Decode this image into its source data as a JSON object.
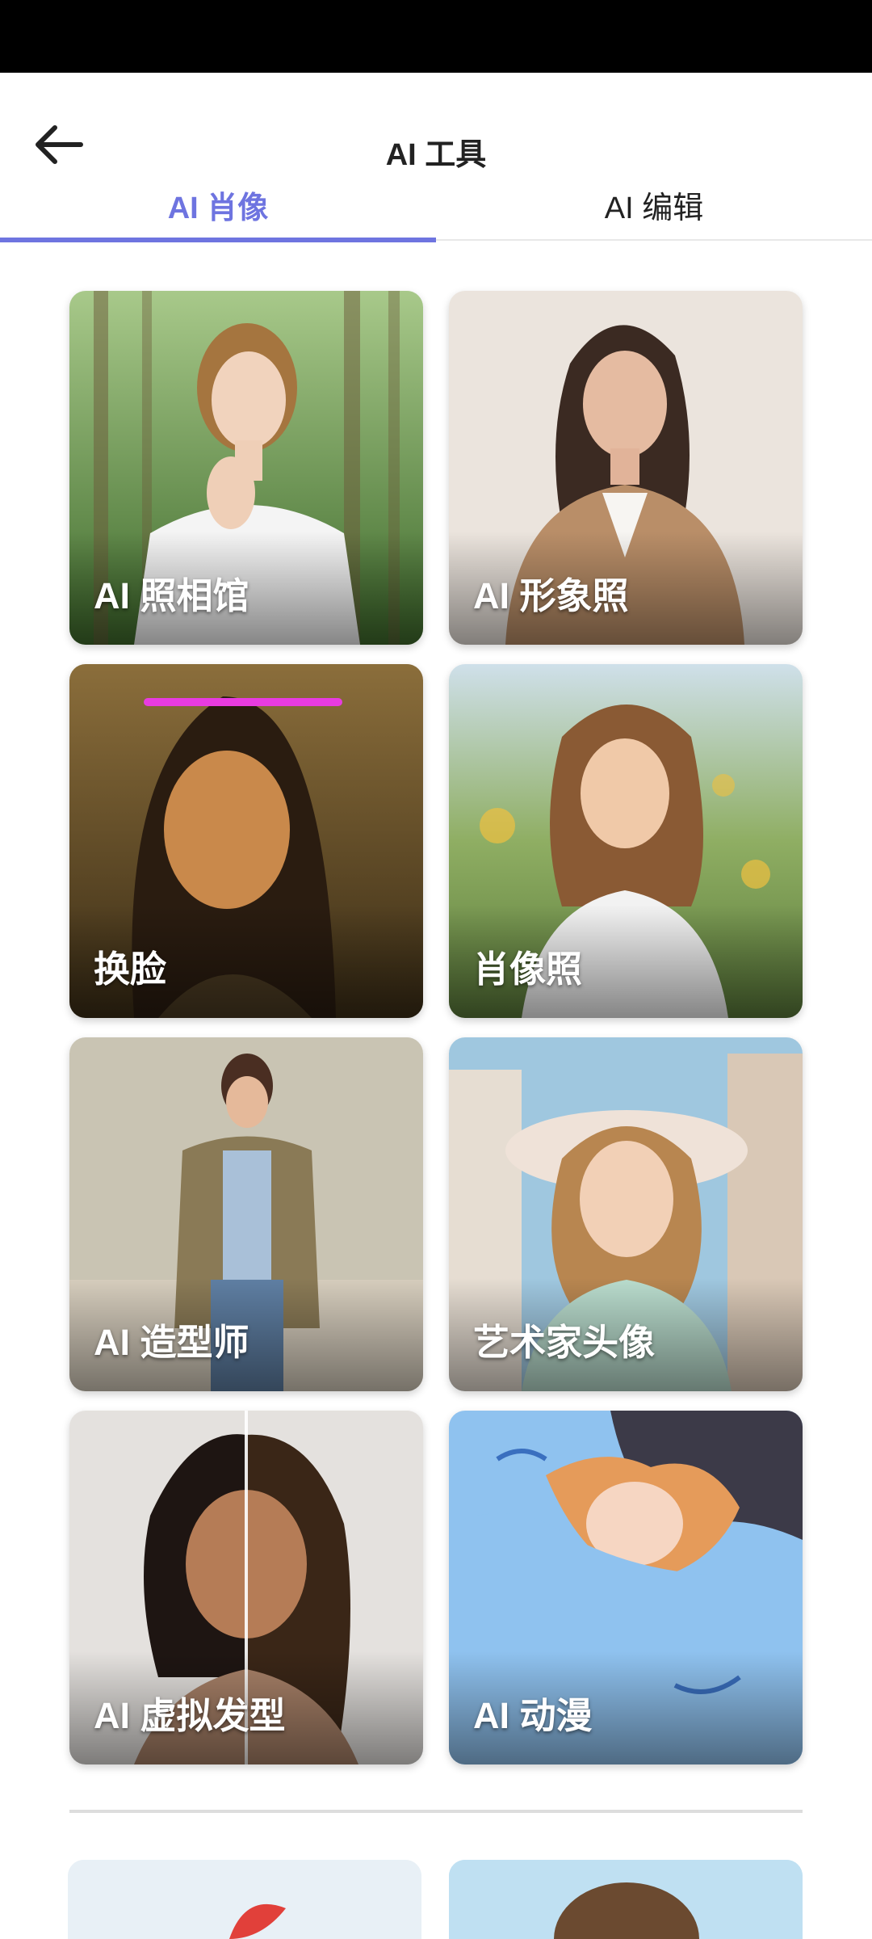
{
  "header": {
    "title": "AI 工具"
  },
  "tabs": [
    {
      "label": "AI 肖像",
      "active": true
    },
    {
      "label": "AI 编辑",
      "active": false
    }
  ],
  "accent_color": "#6e74e0",
  "cards": [
    {
      "label": "AI 照相馆",
      "icon": "portrait-forest-photo"
    },
    {
      "label": "AI 形象照",
      "icon": "portrait-business-photo"
    },
    {
      "label": "换脸",
      "icon": "face-swap-painting"
    },
    {
      "label": "肖像照",
      "icon": "portrait-outdoor-photo"
    },
    {
      "label": "AI 造型师",
      "icon": "fashion-stylist-photo"
    },
    {
      "label": "艺术家头像",
      "icon": "artistic-avatar"
    },
    {
      "label": "AI 虚拟发型",
      "icon": "virtual-hairstyle-photo"
    },
    {
      "label": "AI 动漫",
      "icon": "anime-transform"
    }
  ]
}
